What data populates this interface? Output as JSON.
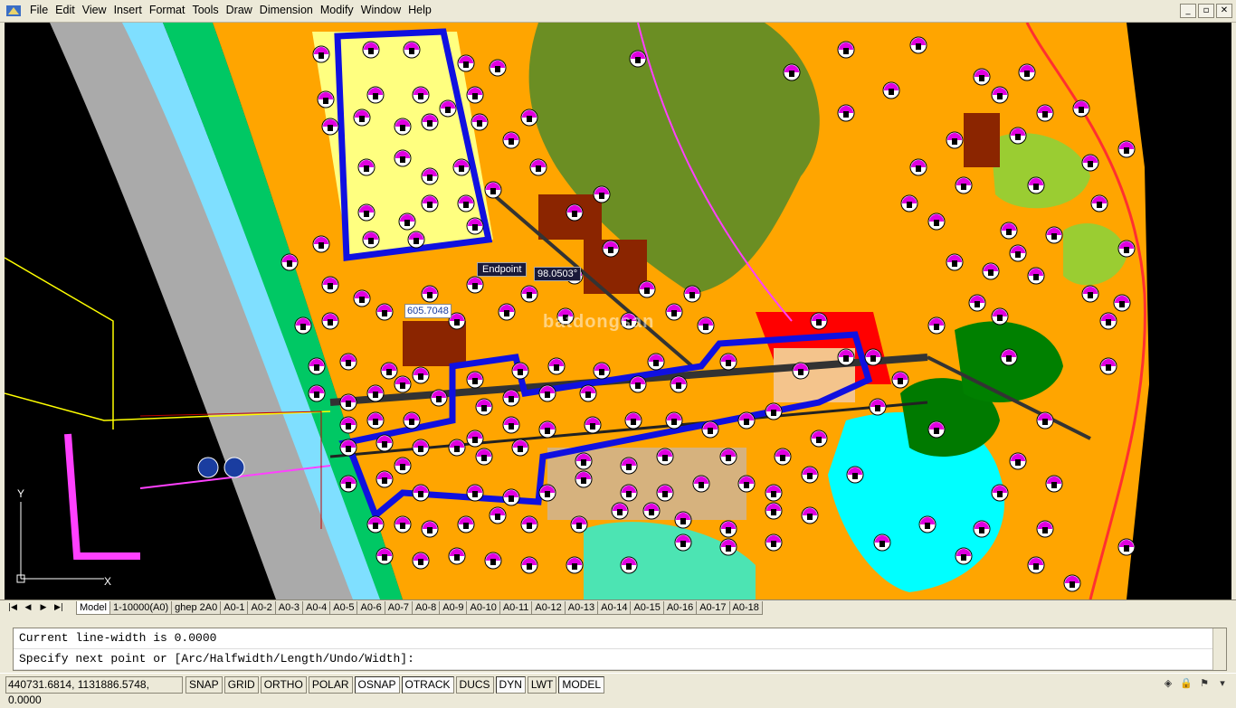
{
  "menu": [
    "File",
    "Edit",
    "View",
    "Insert",
    "Format",
    "Tools",
    "Draw",
    "Dimension",
    "Modify",
    "Window",
    "Help"
  ],
  "window_controls": [
    "_",
    "▫",
    "✕"
  ],
  "canvas": {
    "tooltip": "Endpoint",
    "angle": "98.0503°",
    "length": "605.7048",
    "watermark": "batdongsan"
  },
  "tabs": {
    "nav": [
      "|◀",
      "◀",
      "▶",
      "▶|"
    ],
    "items": [
      "Model",
      "1-10000(A0)",
      "ghep 2A0",
      "A0-1",
      "A0-2",
      "A0-3",
      "A0-4",
      "A0-5",
      "A0-6",
      "A0-7",
      "A0-8",
      "A0-9",
      "A0-10",
      "A0-11",
      "A0-12",
      "A0-13",
      "A0-14",
      "A0-15",
      "A0-16",
      "A0-17",
      "A0-18"
    ],
    "active": "Model"
  },
  "command": {
    "line1": "Current line-width is 0.0000",
    "line2": "Specify next point or [Arc/Halfwidth/Length/Undo/Width]:"
  },
  "status": {
    "coords": "440731.6814, 1131886.5748, 0.0000",
    "toggles": [
      "SNAP",
      "GRID",
      "ORTHO",
      "POLAR",
      "OSNAP",
      "OTRACK",
      "DUCS",
      "DYN",
      "LWT",
      "MODEL"
    ],
    "on": [
      "OSNAP",
      "OTRACK",
      "DYN",
      "MODEL"
    ]
  },
  "colors": {
    "background": "#000000",
    "selection_polyline": "#1010e0",
    "residential": "#ffa500",
    "green_space": "#9acd32",
    "water": "#7fdfff",
    "forest": "#6b8e23",
    "commercial": "#c85050"
  }
}
